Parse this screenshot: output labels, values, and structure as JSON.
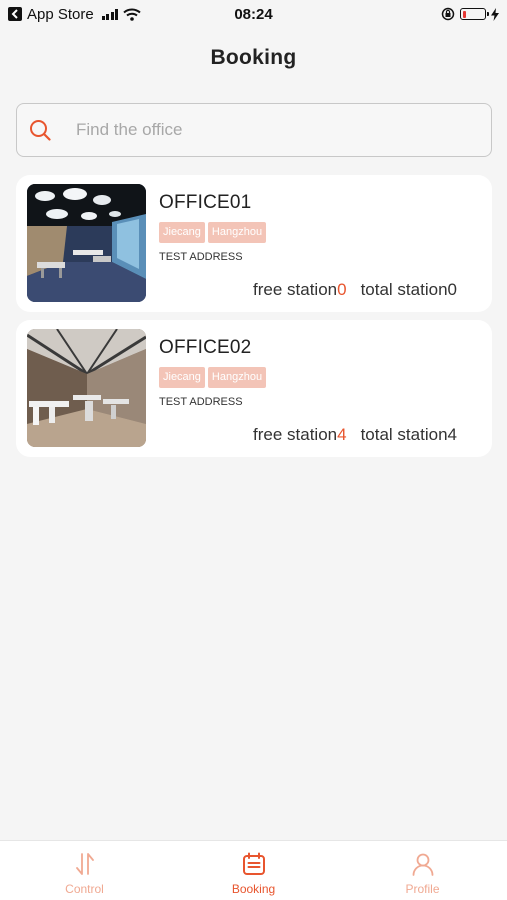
{
  "status_bar": {
    "back_app": "App Store",
    "time": "08:24",
    "battery_level": 0.15
  },
  "page": {
    "title": "Booking"
  },
  "search": {
    "placeholder": "Find the office",
    "value": ""
  },
  "offices": [
    {
      "name": "OFFICE01",
      "tags": [
        "Jiecang",
        "Hangzhou"
      ],
      "address": "TEST ADDRESS",
      "free_label": "free station",
      "free_count": "0",
      "total_label": "total station",
      "total_count": "0"
    },
    {
      "name": "OFFICE02",
      "tags": [
        "Jiecang",
        "Hangzhou"
      ],
      "address": "TEST ADDRESS",
      "free_label": "free station",
      "free_count": "4",
      "total_label": "total station",
      "total_count": "4"
    }
  ],
  "tabbar": {
    "tabs": [
      {
        "label": "Control",
        "icon": "swap-arrows-icon",
        "active": false
      },
      {
        "label": "Booking",
        "icon": "calendar-icon",
        "active": true
      },
      {
        "label": "Profile",
        "icon": "person-icon",
        "active": false
      }
    ]
  },
  "colors": {
    "accent": "#e8552e",
    "tag_bg": "#f3c4b7",
    "inactive_tab": "#f0a992",
    "background": "#f5f5f5"
  }
}
